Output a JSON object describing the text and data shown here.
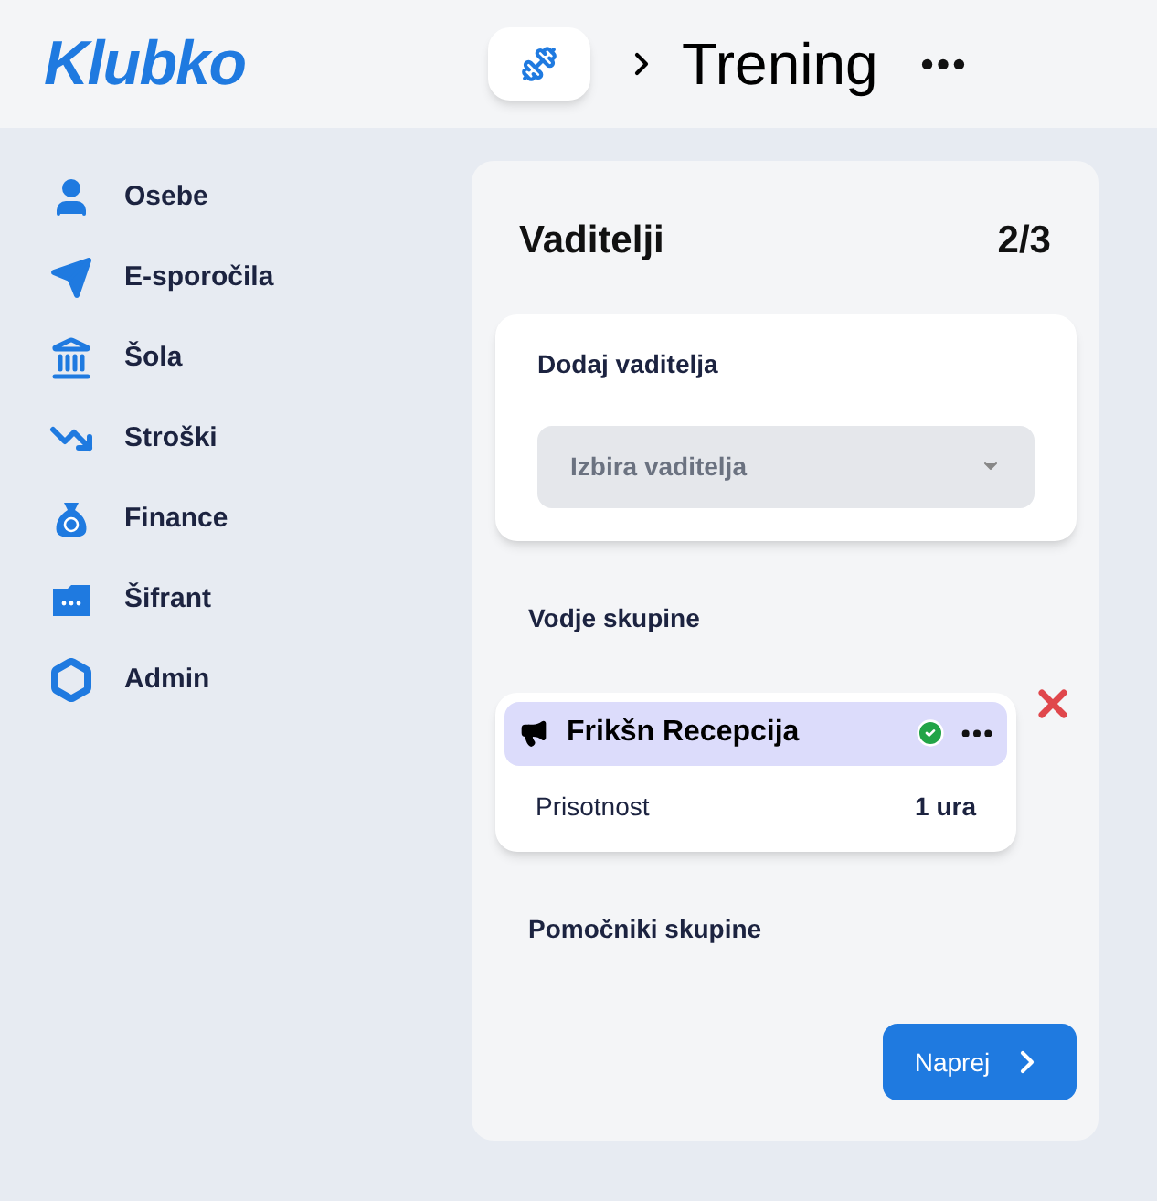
{
  "header": {
    "logo": "Klubko",
    "title": "Trening"
  },
  "sidebar": {
    "items": [
      {
        "label": "Osebe",
        "kind": "person"
      },
      {
        "label": "E-sporočila",
        "kind": "send"
      },
      {
        "label": "Šola",
        "kind": "school"
      },
      {
        "label": "Stroški",
        "kind": "costs"
      },
      {
        "label": "Finance",
        "kind": "money"
      },
      {
        "label": "Šifrant",
        "kind": "folder"
      },
      {
        "label": "Admin",
        "kind": "admin"
      }
    ]
  },
  "panel": {
    "title": "Vaditelji",
    "count": "2/3",
    "add_card": {
      "title": "Dodaj vaditelja",
      "select": {
        "placeholder": "Izbira vaditelja"
      }
    },
    "leaders": {
      "title": "Vodje skupine",
      "items": [
        {
          "name": "Frikšn Recepcija",
          "confirmed": true,
          "label": "Prisotnost",
          "value": "1 ura"
        }
      ]
    },
    "assistants": {
      "title": "Pomočniki skupine"
    },
    "next_button": "Naprej"
  }
}
